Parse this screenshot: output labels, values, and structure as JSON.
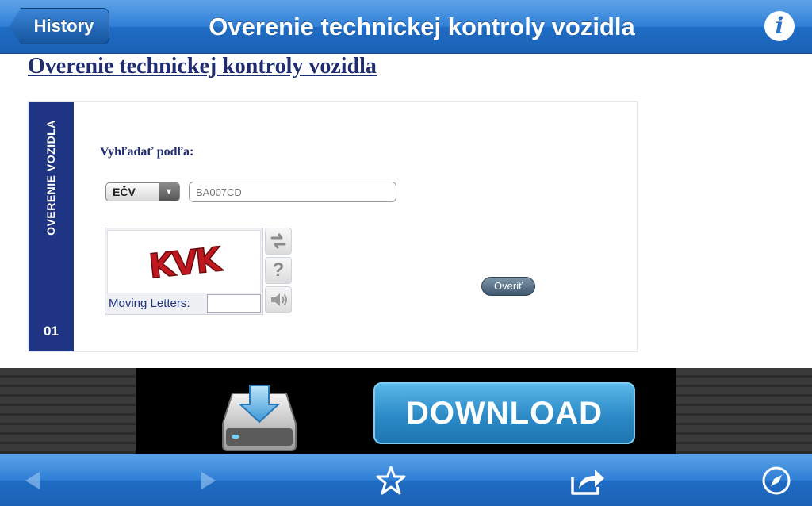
{
  "navbar": {
    "back_label": "History",
    "title": "Overenie technickej kontroly vozidla",
    "info_label": "i"
  },
  "page": {
    "heading": "Overenie technickej kontroly vozidla"
  },
  "form": {
    "side_label": "OVERENIE VOZIDLA",
    "side_number": "01",
    "search_label": "Vyhľadať podľa:",
    "search_type": "EČV",
    "plate_placeholder": "BA007CD",
    "captcha_text": "KVK",
    "captcha_label": "Moving Letters:",
    "tools": {
      "refresh_icon": "refresh-icon",
      "help_label": "?",
      "audio_icon": "speaker-icon"
    },
    "verify_label": "Overiť"
  },
  "ad": {
    "button_label": "DOWNLOAD"
  },
  "toolbar": {
    "icons": [
      "back-arrow-icon",
      "forward-arrow-icon",
      "star-icon",
      "share-icon",
      "compass-icon"
    ]
  },
  "colors": {
    "nav_blue": "#2f7fd7",
    "strip_navy": "#1f3583",
    "heading_navy": "#1f2c6e",
    "ad_blue": "#2c8ac6"
  }
}
